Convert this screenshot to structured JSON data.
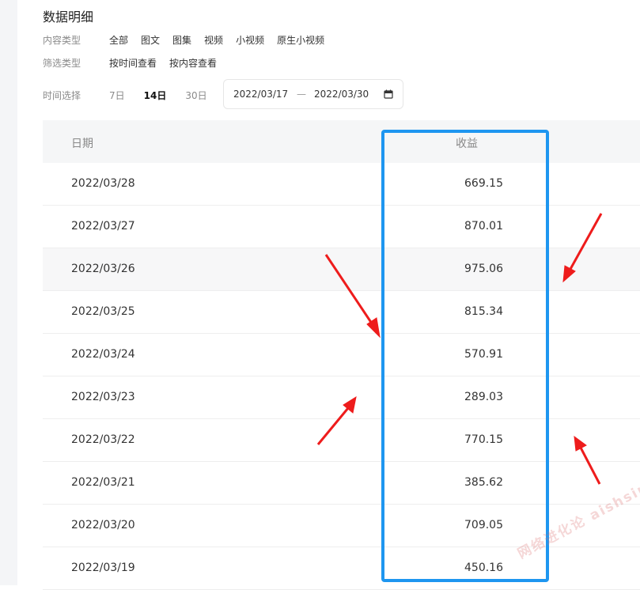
{
  "title": "数据明细",
  "filters": {
    "content_type": {
      "label": "内容类型",
      "options": [
        "全部",
        "图文",
        "图集",
        "视频",
        "小视频",
        "原生小视频"
      ]
    },
    "filter_type": {
      "label": "筛选类型",
      "options": [
        "按时间查看",
        "按内容查看"
      ]
    },
    "time": {
      "label": "时间选择",
      "options": [
        "7日",
        "14日",
        "30日"
      ],
      "selected": "14日"
    }
  },
  "date_range": {
    "start": "2022/03/17",
    "separator": "—",
    "end": "2022/03/30",
    "icon": "calendar-icon"
  },
  "table": {
    "headers": {
      "date": "日期",
      "income": "收益"
    },
    "rows": [
      {
        "date": "2022/03/28",
        "income": "669.15"
      },
      {
        "date": "2022/03/27",
        "income": "870.01"
      },
      {
        "date": "2022/03/26",
        "income": "975.06"
      },
      {
        "date": "2022/03/25",
        "income": "815.34"
      },
      {
        "date": "2022/03/24",
        "income": "570.91"
      },
      {
        "date": "2022/03/23",
        "income": "289.03"
      },
      {
        "date": "2022/03/22",
        "income": "770.15"
      },
      {
        "date": "2022/03/21",
        "income": "385.62"
      },
      {
        "date": "2022/03/20",
        "income": "709.05"
      },
      {
        "date": "2022/03/19",
        "income": "450.16"
      }
    ]
  },
  "annotations": {
    "highlight_color": "#1e96f0",
    "arrow_color": "#ee1c1c"
  },
  "watermark": "网络进化论 aishsing.com"
}
